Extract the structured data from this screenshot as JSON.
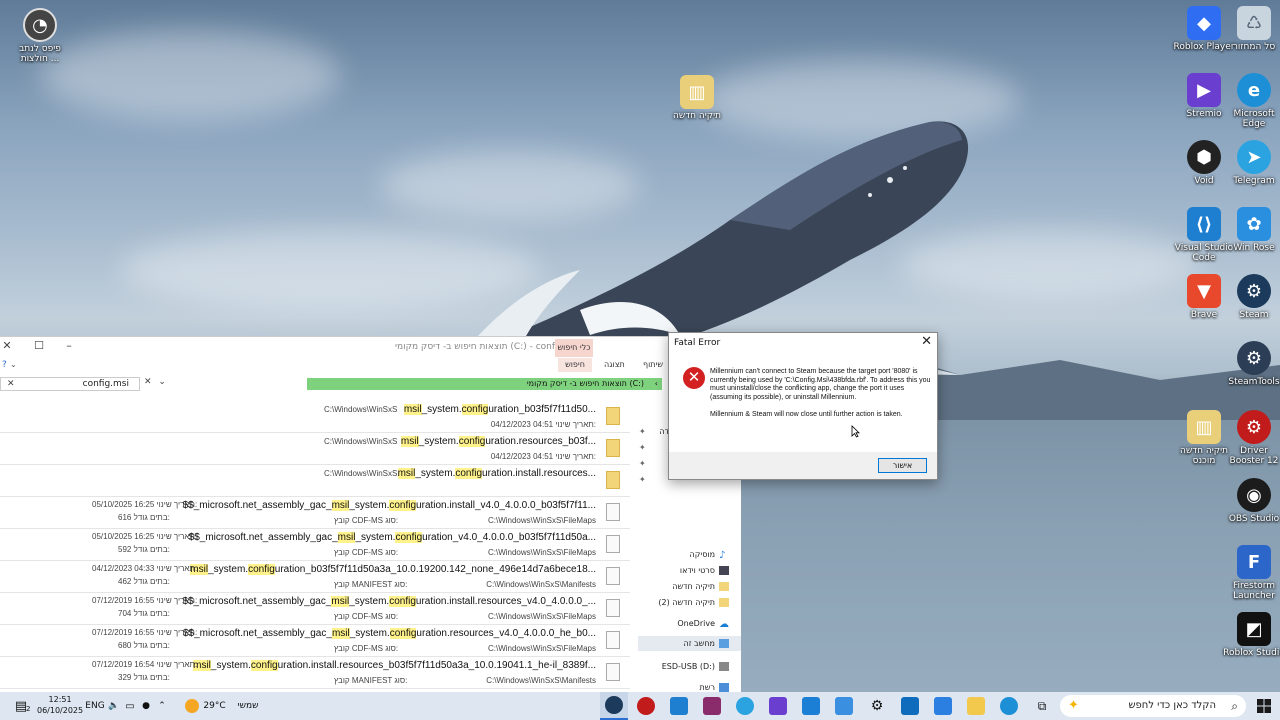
{
  "desktop": {
    "icons": [
      {
        "label": "פיפס לנתב\nחולצות ...",
        "icon": "user-circle-icon"
      },
      {
        "label": "תיקיה חדשה",
        "icon": "zip-folder-icon"
      },
      {
        "label": "Roblox Player",
        "icon": "roblox-icon"
      },
      {
        "label": "סל המחזור",
        "icon": "recycle-bin-icon"
      },
      {
        "label": "Stremio",
        "icon": "stremio-icon"
      },
      {
        "label": "Microsoft Edge",
        "icon": "edge-icon"
      },
      {
        "label": "Void",
        "icon": "void-icon"
      },
      {
        "label": "Telegram",
        "icon": "telegram-icon"
      },
      {
        "label": "Visual Studio Code",
        "icon": "vscode-icon"
      },
      {
        "label": "Win Rose",
        "icon": "winrose-icon"
      },
      {
        "label": "Brave",
        "icon": "brave-icon"
      },
      {
        "label": "Steam",
        "icon": "steam-icon"
      },
      {
        "label": "SteamTools",
        "icon": "steamtools-icon"
      },
      {
        "label": "תיקיה חדשה\nמוכנס",
        "icon": "zip-folder-icon"
      },
      {
        "label": "Driver Booster 12",
        "icon": "driver-booster-icon"
      },
      {
        "label": "OBS Studio",
        "icon": "obs-icon"
      },
      {
        "label": "Firestorm Launcher",
        "icon": "firestorm-icon"
      },
      {
        "label": "Roblox Studio",
        "icon": "roblox-studio-icon"
      }
    ]
  },
  "explorer": {
    "title": "תוצאות חיפוש ב- דיסק מקומי (C:) - config.msi",
    "context_tab": "כלי חיפוש",
    "ribbon": {
      "share": "שיתוף",
      "view": "תצוגה",
      "search": "חיפוש"
    },
    "address": "תוצאות חיפוש ב- דיסק מקומי (C:)",
    "search_value": "config.msi",
    "files": [
      {
        "pre": "",
        "name_parts": [
          "msil",
          "_system.",
          "config",
          "uration_b03f5f7f11d50..."
        ],
        "path": "C:\\Windows\\WinSxS",
        "date_label": "תאריך שינוי:",
        "date": "04/12/2023 04:51",
        "type_label": "",
        "type": "",
        "size_label": "",
        "size": "",
        "folder": true
      },
      {
        "pre": "",
        "name_parts": [
          "msil",
          "_system.",
          "config",
          "uration.resources_b03f..."
        ],
        "path": "C:\\Windows\\WinSxS",
        "date_label": "תאריך שינוי:",
        "date": "04/12/2023 04:51",
        "type_label": "",
        "type": "",
        "size_label": "",
        "size": "",
        "folder": true
      },
      {
        "pre": "",
        "name_parts": [
          "msil",
          "_system.",
          "config",
          "uration.install.resources..."
        ],
        "path": "C:\\Windows\\WinSxS",
        "date_label": "תאריך שינוי:",
        "date": "04/12/2023 04:51",
        "type_label": "",
        "type": "",
        "size_label": "",
        "size": "",
        "folder": true
      },
      {
        "pre": "$$_microsoft.net_assembly_gac_",
        "name_parts": [
          "msil",
          "_system.",
          "config",
          "uration.install_v4.0_4.0.0.0_b03f5f7f11..."
        ],
        "path": "C:\\Windows\\WinSxS\\FileMaps",
        "date_label": "תאריך שינוי:",
        "date": "05/10/2025 16:25",
        "type_label": "סוג:",
        "type": "קובץ CDF-MS",
        "size_label": "גודל:",
        "size": "616 בתים",
        "folder": false
      },
      {
        "pre": "$$_microsoft.net_assembly_gac_",
        "name_parts": [
          "msil",
          "_system.",
          "config",
          "uration_v4.0_4.0.0.0_b03f5f7f11d50a..."
        ],
        "path": "C:\\Windows\\WinSxS\\FileMaps",
        "date_label": "תאריך שינוי:",
        "date": "05/10/2025 16:25",
        "type_label": "סוג:",
        "type": "קובץ CDF-MS",
        "size_label": "גודל:",
        "size": "592 בתים",
        "folder": false
      },
      {
        "pre": "",
        "name_parts": [
          "msil",
          "_system.",
          "config",
          "uration_b03f5f7f11d50a3a_10.0.19200.142_none_496e14d7a6bece18..."
        ],
        "path": "C:\\Windows\\WinSxS\\Manifests",
        "date_label": "תאריך שינוי:",
        "date": "04/12/2023 04:33",
        "type_label": "סוג:",
        "type": "קובץ MANIFEST",
        "size_label": "גודל:",
        "size": "462 בתים",
        "folder": false
      },
      {
        "pre": "$$_microsoft.net_assembly_gac_",
        "name_parts": [
          "msil",
          "_system.",
          "config",
          "uration.install.resources_v4.0_4.0.0.0_..."
        ],
        "path": "C:\\Windows\\WinSxS\\FileMaps",
        "date_label": "תאריך שינוי:",
        "date": "07/12/2019 16:55",
        "type_label": "סוג:",
        "type": "קובץ CDF-MS",
        "size_label": "גודל:",
        "size": "704 בתים",
        "folder": false
      },
      {
        "pre": "$$_microsoft.net_assembly_gac_",
        "name_parts": [
          "msil",
          "_system.",
          "config",
          "uration.resources_v4.0_4.0.0.0_he_b0..."
        ],
        "path": "C:\\Windows\\WinSxS\\FileMaps",
        "date_label": "תאריך שינוי:",
        "date": "07/12/2019 16:55",
        "type_label": "סוג:",
        "type": "קובץ CDF-MS",
        "size_label": "גודל:",
        "size": "680 בתים",
        "folder": false
      },
      {
        "pre": "",
        "name_parts": [
          "msil",
          "_system.",
          "config",
          "uration.install.resources_b03f5f7f11d50a3a_10.0.19041.1_he-il_8389f..."
        ],
        "path": "C:\\Windows\\WinSxS\\Manifests",
        "date_label": "תאריך שינוי:",
        "date": "07/12/2019 16:54",
        "type_label": "סוג:",
        "type": "קובץ MANIFEST",
        "size_label": "גודל:",
        "size": "329 בתים",
        "folder": false
      }
    ],
    "nav": {
      "downloads_partial": "דה",
      "music": "מוסיקה",
      "videos": "סרטי וידאו",
      "new_folder": "תיקיה חדשה",
      "new_folder_2": "תיקיה חדשה (2)",
      "onedrive": "OneDrive",
      "this_pc": "מחשב זה",
      "usb": "ESD-USB (D:)",
      "network": "רשת"
    }
  },
  "dialog": {
    "title": "Fatal Error",
    "message_1": "Millennium can't connect to Steam because the target port '8080' is currently being used by 'C:\\Config.Msi\\438bfda.rbf'. To address this you must uninstall/close the conflicting app, change the port it uses (assuming its possible), or uninstall Millennium.",
    "message_2": "Millennium & Steam will now close until further action is taken.",
    "ok_label": "אישור"
  },
  "taskbar": {
    "search_placeholder": "הקלד כאן כדי לחפש",
    "weather_temp": "29°C",
    "weather_text": "שמשי",
    "lang": "ENG",
    "time": "12:51",
    "date": "06/10/2025",
    "notification_count": "2"
  },
  "colors": {
    "search_highlight": "#fff28a",
    "address_bar": "#7fd27d",
    "error_red": "#d32020",
    "taskbar": "#dde6f1"
  }
}
